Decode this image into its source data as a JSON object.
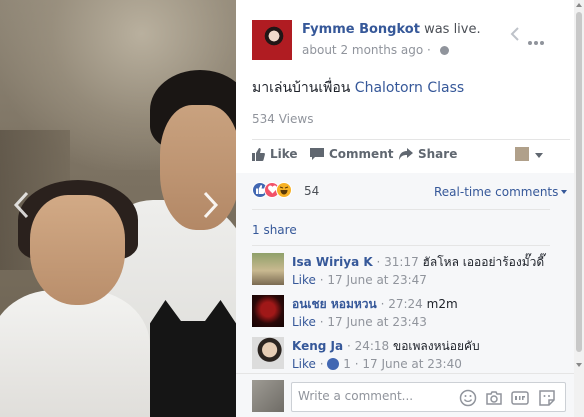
{
  "photo": {
    "prev_icon": "chevron-left-icon",
    "next_icon": "chevron-right-icon"
  },
  "post": {
    "owner_name": "Fymme Bongkot",
    "status_text": "was live.",
    "time_ago": "about 2 months ago",
    "separator": "·",
    "audience_icon": "globe-icon",
    "text": "มาเล่นบ้านเพื่อน ",
    "tagged_link": "Chalotorn Class",
    "views": "534 Views"
  },
  "actions": {
    "like_label": "Like",
    "comment_label": "Comment",
    "share_label": "Share"
  },
  "reactions": {
    "types": [
      "like",
      "love",
      "haha"
    ],
    "count": "54",
    "sort_label": "Real-time comments"
  },
  "shares": {
    "label": "1 share"
  },
  "comments": [
    {
      "name": "Isa Wiriya K",
      "timestamp": "· 31:17",
      "text": "ฮัลโหล เอออย่าร้องมั๊วดี๊",
      "like_label": "Like",
      "date": "17 June at 23:47",
      "like_count": ""
    },
    {
      "name": "อนเชย หอมหวน",
      "timestamp": "· 27:24",
      "text": "m2m",
      "like_label": "Like",
      "date": "17 June at 23:43",
      "like_count": ""
    },
    {
      "name": "Keng Ja",
      "timestamp": "· 24:18",
      "text": "ขอเพลงหน่อยคับ",
      "like_label": "Like",
      "date": "17 June at 23:40",
      "like_count": "1"
    }
  ],
  "composer": {
    "placeholder": "Write a comment...",
    "icons": [
      "emoji-icon",
      "camera-icon",
      "gif-icon",
      "sticker-icon"
    ]
  },
  "colors": {
    "link": "#365899",
    "muted": "#90949c",
    "like_blue": "#4267b2",
    "love_red": "#f25268",
    "haha_yellow": "#f7b125"
  }
}
